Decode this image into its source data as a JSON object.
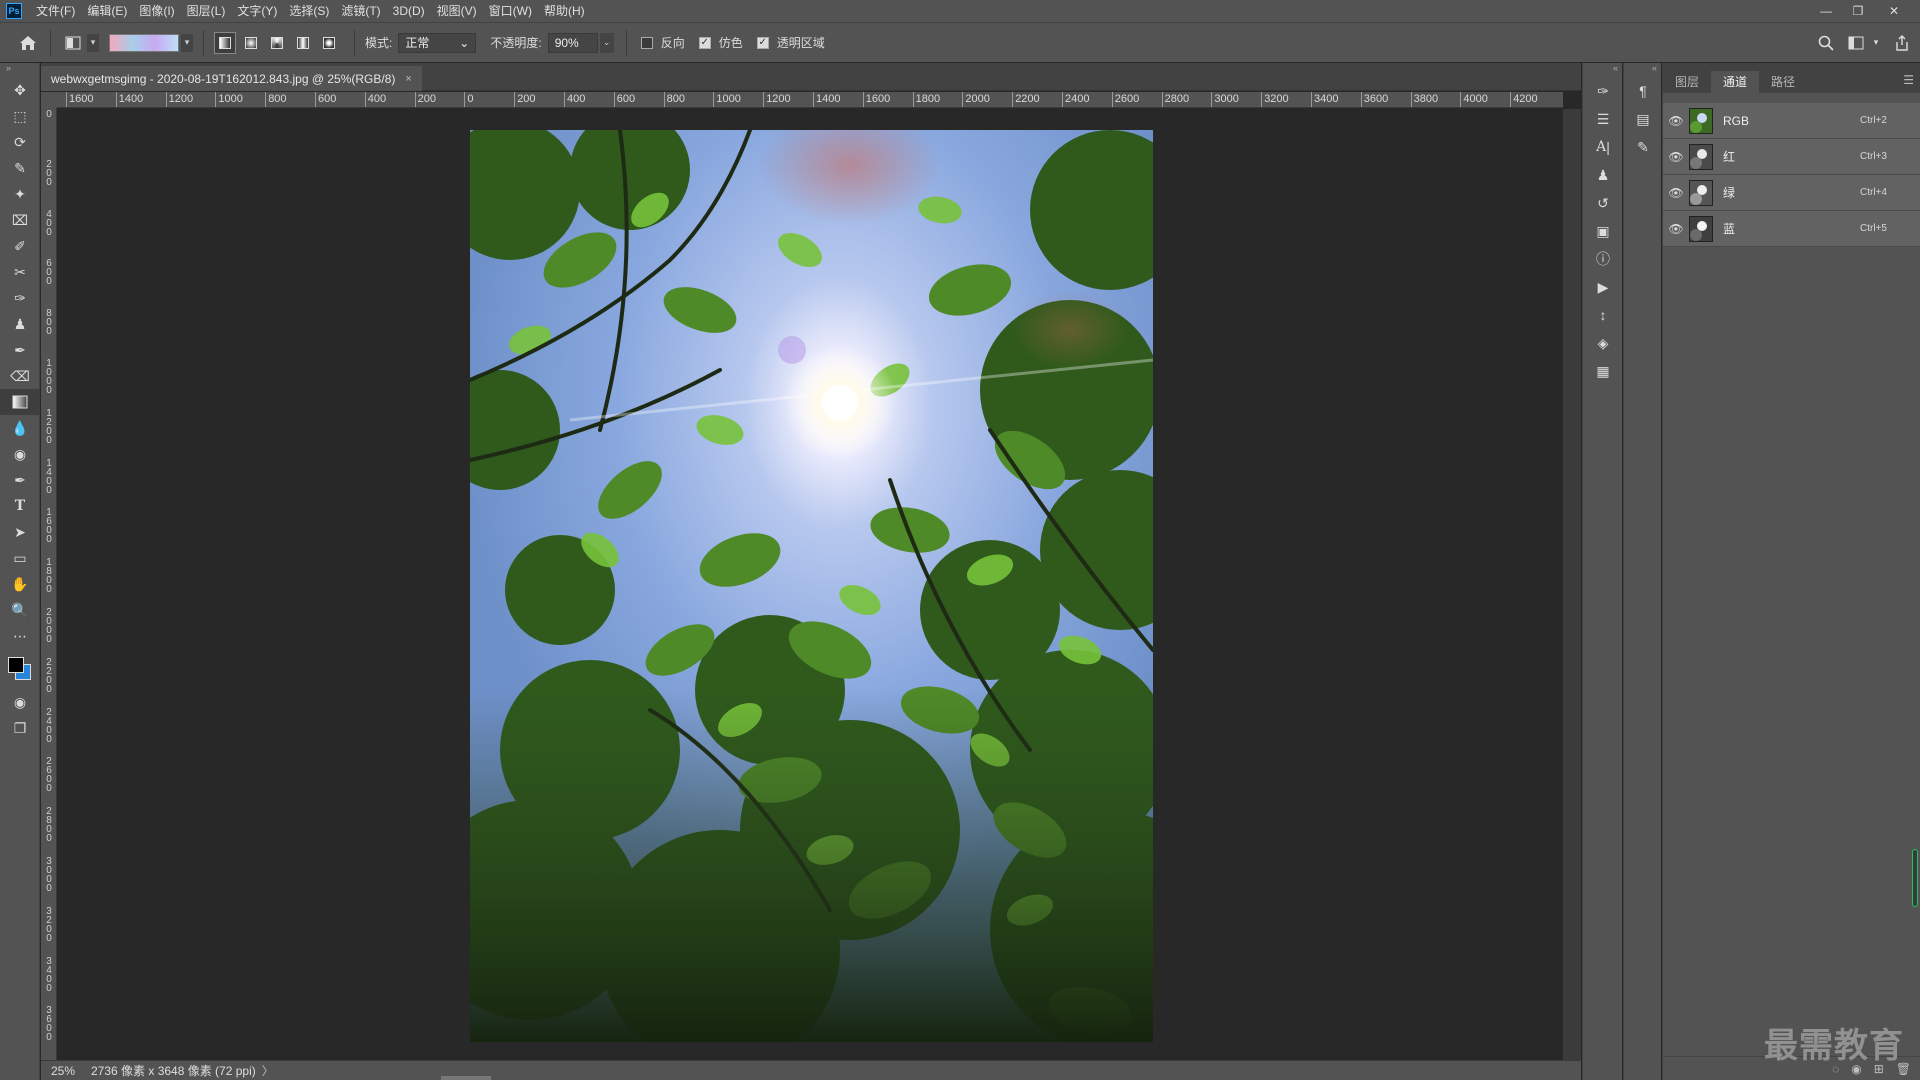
{
  "app": {
    "logo": "Ps",
    "menu": [
      "文件(F)",
      "编辑(E)",
      "图像(I)",
      "图层(L)",
      "文字(Y)",
      "选择(S)",
      "滤镜(T)",
      "3D(D)",
      "视图(V)",
      "窗口(W)",
      "帮助(H)"
    ]
  },
  "options_bar": {
    "mode_label": "模式:",
    "mode_value": "正常",
    "opacity_label": "不透明度:",
    "opacity_value": "90%",
    "reverse_label": "反向",
    "reverse_checked": false,
    "dither_label": "仿色",
    "dither_checked": true,
    "transparency_label": "透明区域",
    "transparency_checked": true
  },
  "document": {
    "tab_title": "webwxgetmsgimg - 2020-08-19T162012.843.jpg @ 25%(RGB/8)",
    "close_glyph": "×"
  },
  "ruler_top": [
    "1600",
    "1400",
    "1200",
    "1000",
    "800",
    "600",
    "400",
    "200",
    "0",
    "200",
    "400",
    "600",
    "800",
    "1000",
    "1200",
    "1400",
    "1600",
    "1800",
    "2000",
    "2200",
    "2400",
    "2600",
    "2800",
    "3000",
    "3200",
    "3400",
    "3600",
    "3800",
    "4000",
    "4200"
  ],
  "ruler_left": [
    "0",
    "2 0 0",
    "4 0 0",
    "6 0 0",
    "8 0 0",
    "1 0 0 0",
    "1 2 0 0",
    "1 4 0 0",
    "1 6 0 0",
    "1 8 0 0",
    "2 0 0 0",
    "2 2 0 0",
    "2 4 0 0",
    "2 6 0 0",
    "2 8 0 0",
    "3 0 0 0",
    "3 2 0 0",
    "3 4 0 0",
    "3 6 0 0"
  ],
  "status_bar": {
    "zoom": "25%",
    "info": "2736 像素 x 3648 像素 (72 ppi)",
    "arrow": "〉"
  },
  "channels_panel": {
    "tabs": [
      "图层",
      "通道",
      "路径"
    ],
    "active_tab": "通道",
    "channels": [
      {
        "name": "RGB",
        "hotkey": "Ctrl+2"
      },
      {
        "name": "红",
        "hotkey": "Ctrl+3"
      },
      {
        "name": "绿",
        "hotkey": "Ctrl+4"
      },
      {
        "name": "蓝",
        "hotkey": "Ctrl+5"
      }
    ]
  },
  "watermark": "最需教育",
  "colors": {
    "foreground": "#000000",
    "background": "#2685d9",
    "ui_panel": "#535353",
    "ui_canvas": "#282828"
  }
}
